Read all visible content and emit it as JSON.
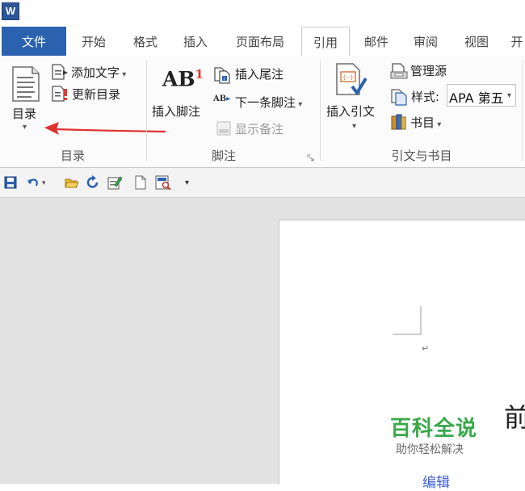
{
  "app": {
    "icon_letter": "W"
  },
  "tabs": [
    {
      "label": "文件"
    },
    {
      "label": "开始"
    },
    {
      "label": "格式"
    },
    {
      "label": "插入"
    },
    {
      "label": "页面布局"
    },
    {
      "label": "引用"
    },
    {
      "label": "邮件"
    },
    {
      "label": "审阅"
    },
    {
      "label": "视图"
    },
    {
      "label": "开"
    }
  ],
  "ribbon": {
    "toc": {
      "big_button_label": "目录",
      "add_text": "添加文字",
      "update_toc": "更新目录",
      "group_label": "目录"
    },
    "footnotes": {
      "ab_text": "AB",
      "ab_sup": "1",
      "insert_footnote": "插入脚注",
      "insert_endnote": "插入尾注",
      "next_footnote": "下一条脚注",
      "next_icon_text": "AB",
      "show_notes": "显示备注",
      "group_label": "脚注"
    },
    "citations": {
      "insert_citation": "插入引文",
      "manage_sources": "管理源",
      "style_label": "样式:",
      "style_value": "APA 第五",
      "bibliography": "书目",
      "group_label": "引文与书目"
    },
    "accent": "#2a62b0",
    "annotation_arrow_color": "#e03030"
  },
  "document": {
    "paragraph_mark": "↵",
    "big_glyph": "前"
  },
  "watermark": {
    "title": "百科全说",
    "subtitle": "助你轻松解决",
    "edit_link": "编辑",
    "color": "#3aa84b"
  }
}
